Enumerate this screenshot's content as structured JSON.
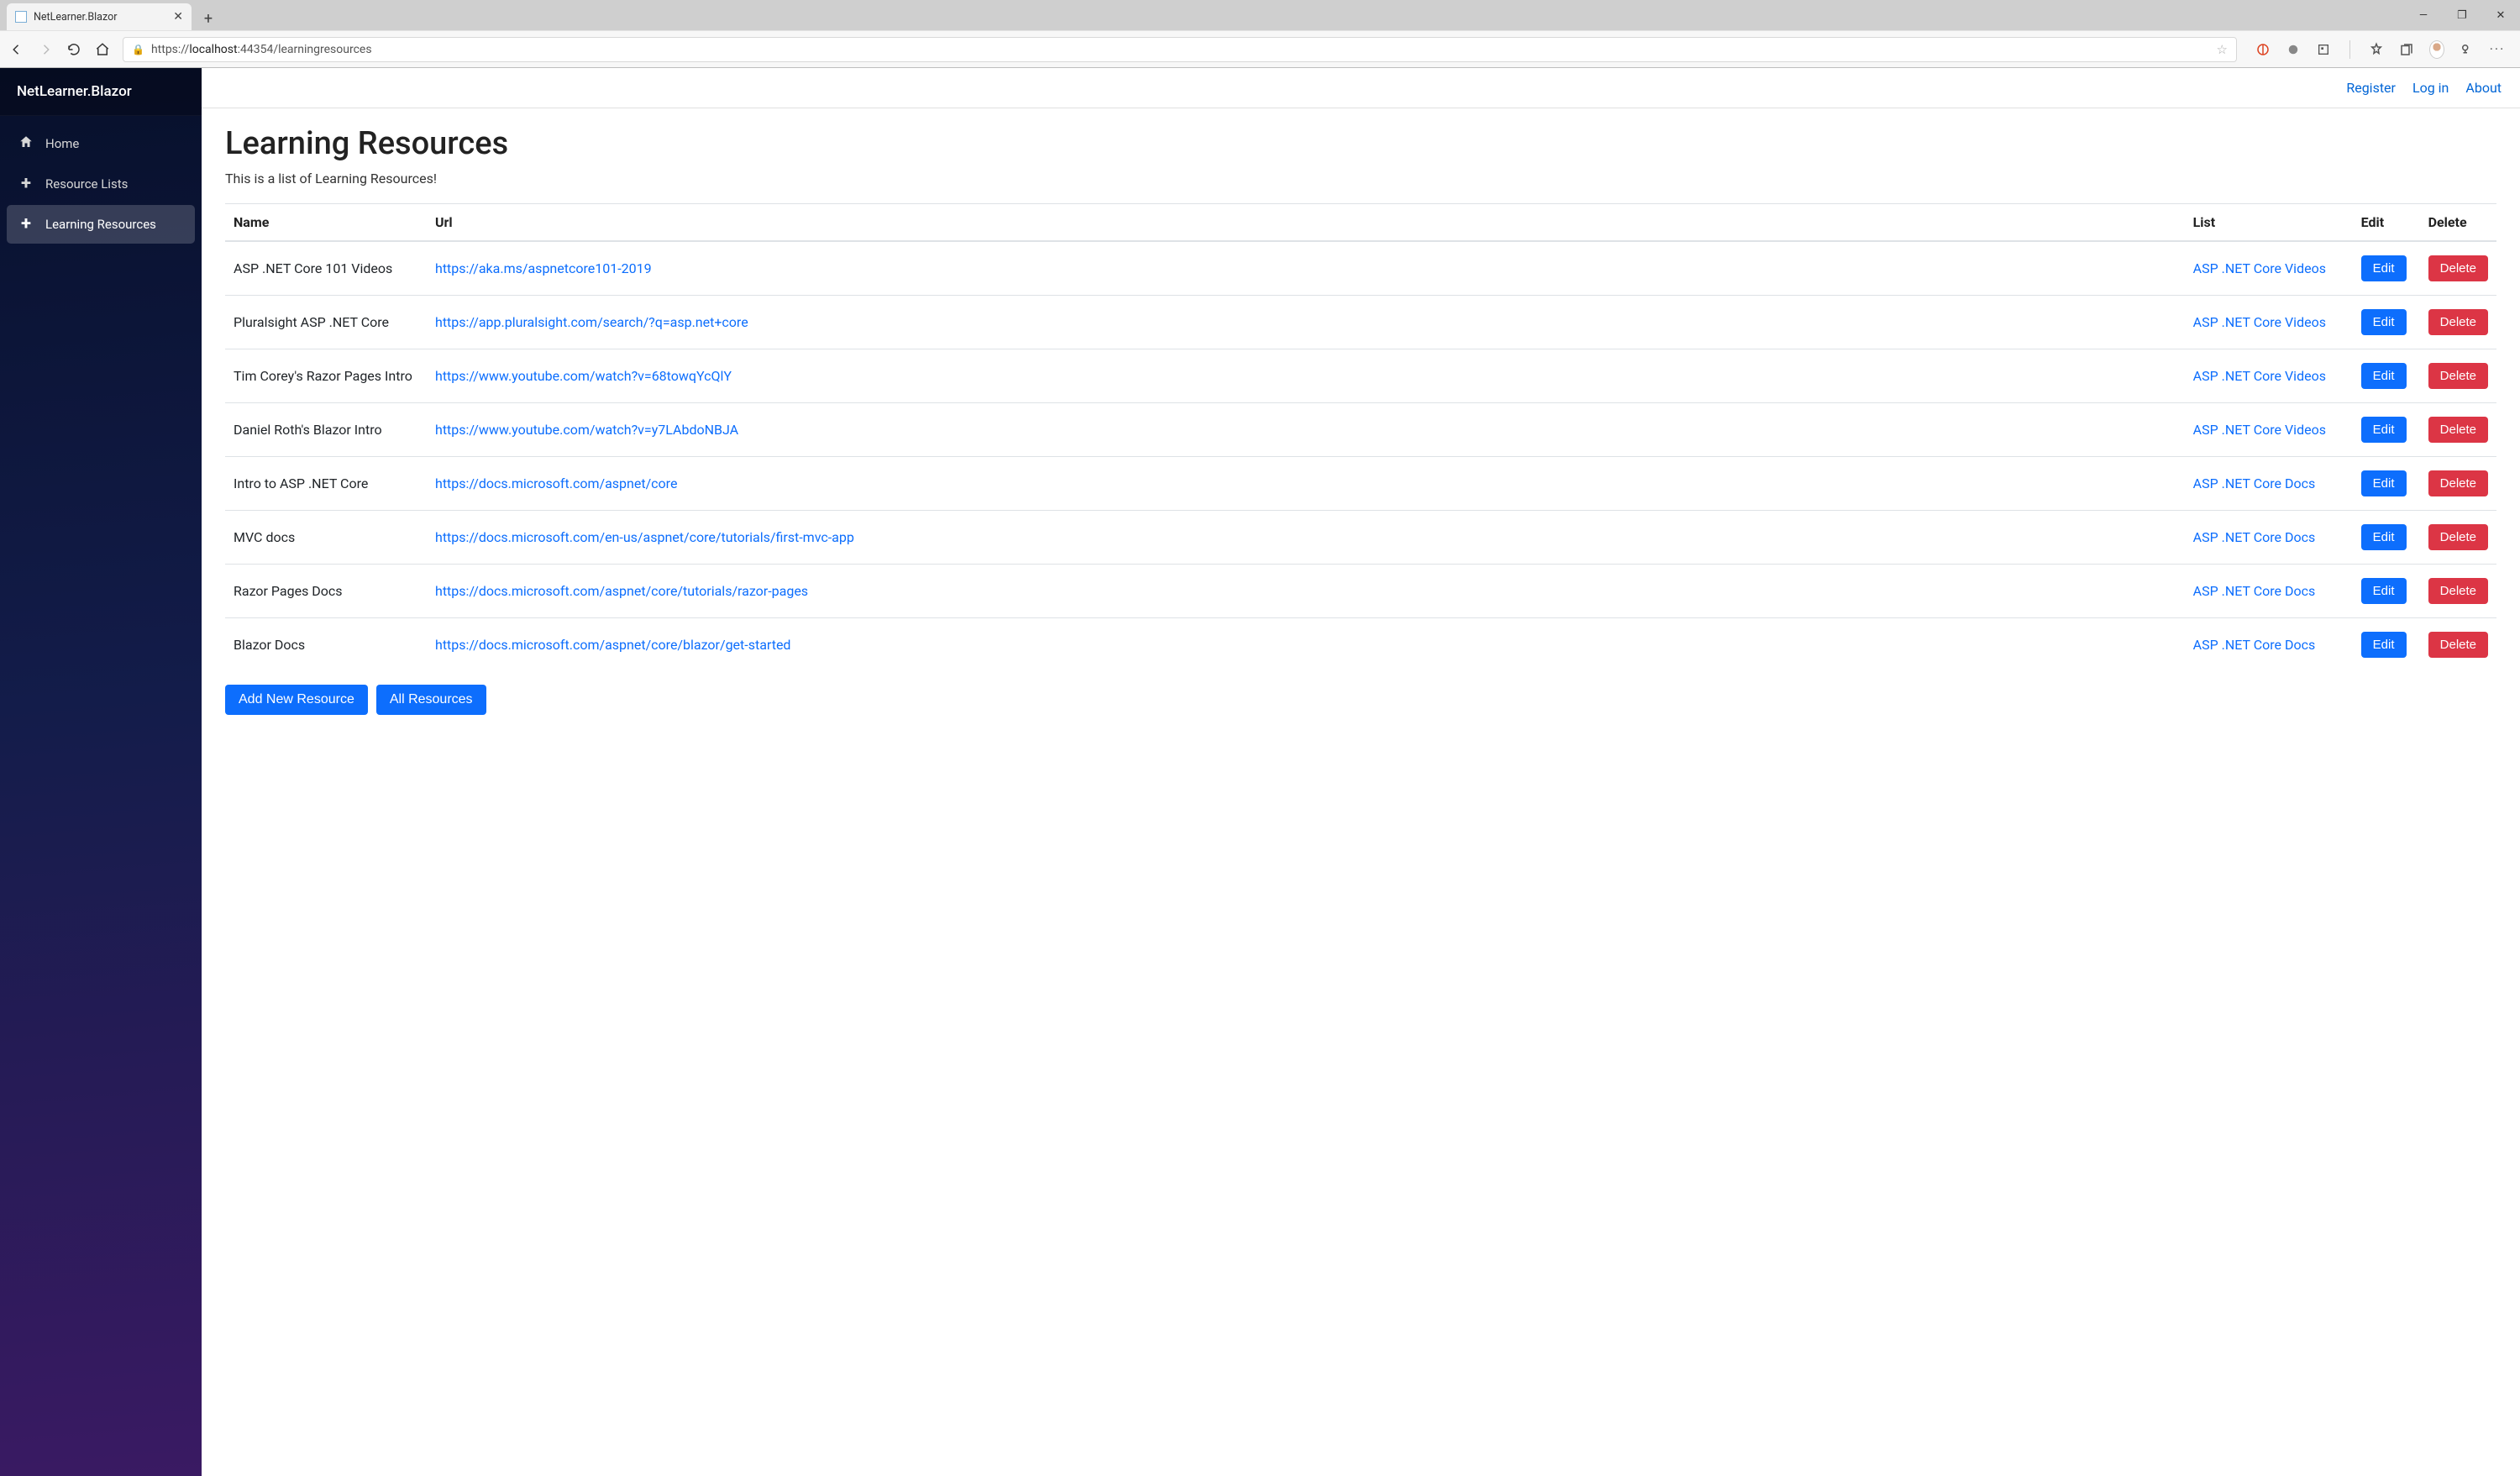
{
  "browser": {
    "tab_title": "NetLearner.Blazor",
    "url_prefix": "https://",
    "url_host": "localhost",
    "url_port": ":44354",
    "url_path": "/learningresources"
  },
  "sidebar": {
    "brand": "NetLearner.Blazor",
    "items": [
      {
        "label": "Home",
        "icon": "home"
      },
      {
        "label": "Resource Lists",
        "icon": "plus"
      },
      {
        "label": "Learning Resources",
        "icon": "plus"
      }
    ],
    "active_index": 2
  },
  "topbar": {
    "register": "Register",
    "login": "Log in",
    "about": "About"
  },
  "page": {
    "heading": "Learning Resources",
    "subtitle": "This is a list of Learning Resources!",
    "columns": {
      "name": "Name",
      "url": "Url",
      "list": "List",
      "edit": "Edit",
      "delete": "Delete"
    },
    "edit_label": "Edit",
    "delete_label": "Delete",
    "rows": [
      {
        "name": "ASP .NET Core 101 Videos",
        "url": "https://aka.ms/aspnetcore101-2019",
        "list": "ASP .NET Core Videos"
      },
      {
        "name": "Pluralsight ASP .NET Core",
        "url": "https://app.pluralsight.com/search/?q=asp.net+core",
        "list": "ASP .NET Core Videos"
      },
      {
        "name": "Tim Corey's Razor Pages Intro",
        "url": "https://www.youtube.com/watch?v=68towqYcQlY",
        "list": "ASP .NET Core Videos"
      },
      {
        "name": "Daniel Roth's Blazor Intro",
        "url": "https://www.youtube.com/watch?v=y7LAbdoNBJA",
        "list": "ASP .NET Core Videos"
      },
      {
        "name": "Intro to ASP .NET Core",
        "url": "https://docs.microsoft.com/aspnet/core",
        "list": "ASP .NET Core Docs"
      },
      {
        "name": "MVC docs",
        "url": "https://docs.microsoft.com/en-us/aspnet/core/tutorials/first-mvc-app",
        "list": "ASP .NET Core Docs"
      },
      {
        "name": "Razor Pages Docs",
        "url": "https://docs.microsoft.com/aspnet/core/tutorials/razor-pages",
        "list": "ASP .NET Core Docs"
      },
      {
        "name": "Blazor Docs",
        "url": "https://docs.microsoft.com/aspnet/core/blazor/get-started",
        "list": "ASP .NET Core Docs"
      }
    ],
    "add_button": "Add New Resource",
    "all_button": "All Resources"
  }
}
